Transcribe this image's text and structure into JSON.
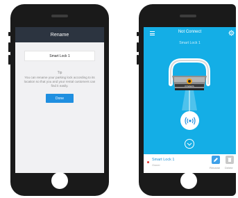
{
  "rename_screen": {
    "title": "Rename",
    "name_value": "Smart Lock 1",
    "tip_title": "Tip",
    "tip_text": "You can rename your parking lock according to its location so that you and your rental customers can find it easily.",
    "done_label": "Done"
  },
  "main_screen": {
    "status_title": "Not Connect",
    "lock_name": "Smart Lock 1",
    "device_brand": "POWERS",
    "connect_icon": "bluetooth-signal-icon",
    "expand_icon": "chevron-down-icon",
    "bottom_lock_name": "Smart Lock 1",
    "bottom_lock_role": "Owner",
    "rename_label": "Rename",
    "delete_label": "Delete"
  },
  "colors": {
    "accent_blue": "#14aee6",
    "button_blue": "#1f8fe0",
    "dark_nav": "#2c3440",
    "status_red": "#e5352f"
  }
}
